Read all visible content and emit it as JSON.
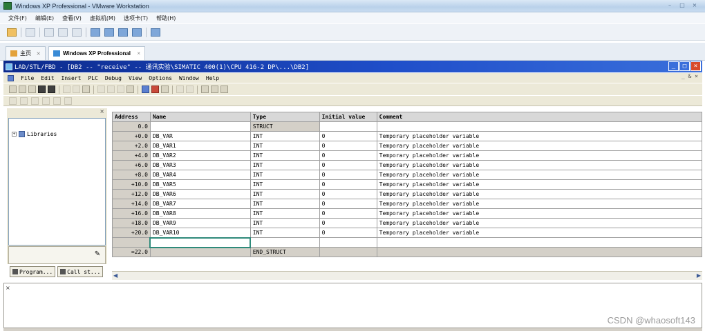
{
  "vmware": {
    "title": "Windows XP Professional - VMware Workstation",
    "menu": [
      "文件(F)",
      "编辑(E)",
      "查看(V)",
      "虚拟机(M)",
      "选项卡(T)",
      "帮助(H)"
    ],
    "tabs": [
      {
        "label": "主页",
        "close": "×"
      },
      {
        "label": "Windows XP Professional",
        "close": "×"
      }
    ],
    "window_controls": [
      "–",
      "□",
      "×"
    ]
  },
  "s7": {
    "title": "LAD/STL/FBD  - [DB2 -- \"receive\" -- 通讯实验\\SIMATIC 400(1)\\CPU 416-2 DP\\...\\DB2]",
    "menu": [
      "File",
      "Edit",
      "Insert",
      "PLC",
      "Debug",
      "View",
      "Options",
      "Window",
      "Help"
    ],
    "menu_right": "_ & ×",
    "window_controls": [
      "_",
      "□",
      "×"
    ],
    "left_pane": {
      "close": "×",
      "tree_item": "Libraries",
      "tree_expander": "+",
      "tabs": [
        "Program...",
        "Call st..."
      ]
    },
    "table": {
      "headers": {
        "address": "Address",
        "name": "Name",
        "type": "Type",
        "initial": "Initial value",
        "comment": "Comment"
      },
      "struct_row": {
        "address": "0.0",
        "type": "STRUCT"
      },
      "rows": [
        {
          "address": "+0.0",
          "name": "DB_VAR",
          "type": "INT",
          "initial": "0",
          "comment": "Temporary placeholder variable"
        },
        {
          "address": "+2.0",
          "name": "DB_VAR1",
          "type": "INT",
          "initial": "0",
          "comment": "Temporary placeholder variable"
        },
        {
          "address": "+4.0",
          "name": "DB_VAR2",
          "type": "INT",
          "initial": "0",
          "comment": "Temporary placeholder variable"
        },
        {
          "address": "+6.0",
          "name": "DB_VAR3",
          "type": "INT",
          "initial": "0",
          "comment": "Temporary placeholder variable"
        },
        {
          "address": "+8.0",
          "name": "DB_VAR4",
          "type": "INT",
          "initial": "0",
          "comment": "Temporary placeholder variable"
        },
        {
          "address": "+10.0",
          "name": "DB_VAR5",
          "type": "INT",
          "initial": "0",
          "comment": "Temporary placeholder variable"
        },
        {
          "address": "+12.0",
          "name": "DB_VAR6",
          "type": "INT",
          "initial": "0",
          "comment": "Temporary placeholder variable"
        },
        {
          "address": "+14.0",
          "name": "DB_VAR7",
          "type": "INT",
          "initial": "0",
          "comment": "Temporary placeholder variable"
        },
        {
          "address": "+16.0",
          "name": "DB_VAR8",
          "type": "INT",
          "initial": "0",
          "comment": "Temporary placeholder variable"
        },
        {
          "address": "+18.0",
          "name": "DB_VAR9",
          "type": "INT",
          "initial": "0",
          "comment": "Temporary placeholder variable"
        },
        {
          "address": "+20.0",
          "name": "DB_VAR10",
          "type": "INT",
          "initial": "0",
          "comment": "Temporary placeholder variable"
        }
      ],
      "end_row": {
        "address": "=22.0",
        "type": "END_STRUCT"
      }
    }
  },
  "watermark": "CSDN @whaosoft143",
  "colors": {
    "s7_title_start": "#0c2a8c",
    "s7_title_end": "#3a6fdb",
    "selected_cell_border": "#2e8a7a",
    "window_face": "#ece9d8"
  }
}
